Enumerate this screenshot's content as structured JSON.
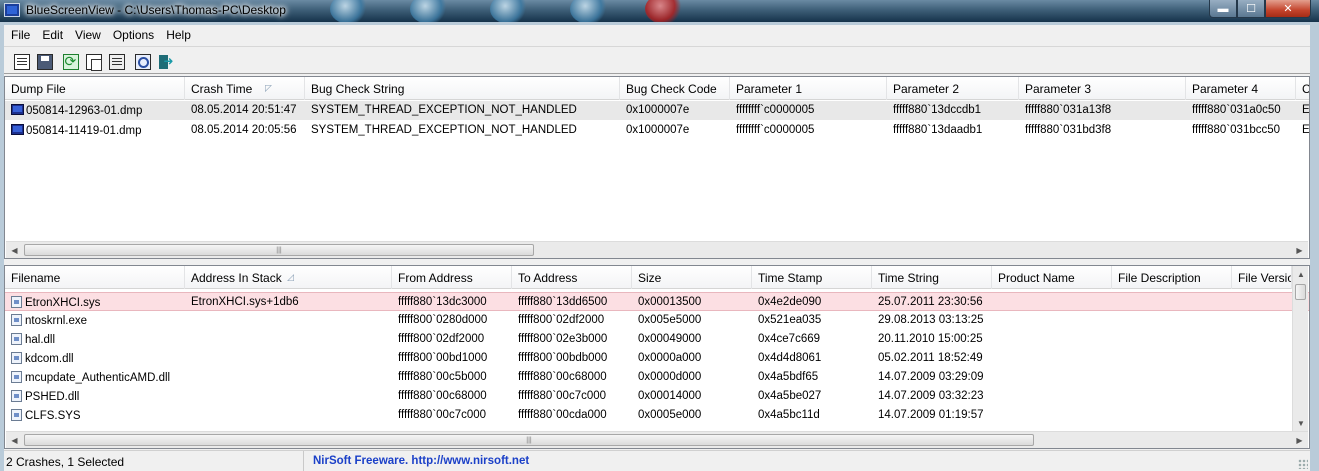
{
  "window": {
    "title": "BlueScreenView  -  C:\\Users\\Thomas-PC\\Desktop",
    "minimize_label": "▬",
    "maximize_label": "☐",
    "close_label": "✕"
  },
  "menu": [
    "File",
    "Edit",
    "View",
    "Options",
    "Help"
  ],
  "toolbar": [
    {
      "name": "html-report-icon",
      "type": "report"
    },
    {
      "name": "save-icon",
      "type": "save"
    },
    {
      "name": "refresh-icon",
      "type": "refresh"
    },
    {
      "name": "copy-icon",
      "type": "copy"
    },
    {
      "name": "properties-icon",
      "type": "props"
    },
    {
      "name": "find-icon",
      "type": "find"
    },
    {
      "name": "exit-icon",
      "type": "exit"
    }
  ],
  "crash_list": {
    "columns": [
      "Dump File",
      "Crash Time",
      "Bug Check String",
      "Bug Check Code",
      "Parameter 1",
      "Parameter 2",
      "Parameter 3",
      "Parameter 4",
      "C"
    ],
    "rows": [
      [
        "050814-12963-01.dmp",
        "08.05.2014 20:51:47",
        "SYSTEM_THREAD_EXCEPTION_NOT_HANDLED",
        "0x1000007e",
        "ffffffff`c0000005",
        "fffff880`13dccdb1",
        "fffff880`031a13f8",
        "fffff880`031a0c50",
        "E"
      ],
      [
        "050814-11419-01.dmp",
        "08.05.2014 20:05:56",
        "SYSTEM_THREAD_EXCEPTION_NOT_HANDLED",
        "0x1000007e",
        "ffffffff`c0000005",
        "fffff880`13daadb1",
        "fffff880`031bd3f8",
        "fffff880`031bcc50",
        "E"
      ]
    ],
    "selected_row": 0
  },
  "driver_list": {
    "columns": [
      "Filename",
      "Address In Stack",
      "From Address",
      "To Address",
      "Size",
      "Time Stamp",
      "Time String",
      "Product Name",
      "File Description",
      "File Versio"
    ],
    "rows": [
      [
        "EtronXHCI.sys",
        "EtronXHCI.sys+1db6",
        "fffff880`13dc3000",
        "fffff880`13dd6500",
        "0x00013500",
        "0x4e2de090",
        "25.07.2011 23:30:56",
        "",
        "",
        ""
      ],
      [
        "ntoskrnl.exe",
        "",
        "fffff800`0280d000",
        "fffff800`02df2000",
        "0x005e5000",
        "0x521ea035",
        "29.08.2013 03:13:25",
        "",
        "",
        ""
      ],
      [
        "hal.dll",
        "",
        "fffff800`02df2000",
        "fffff800`02e3b000",
        "0x00049000",
        "0x4ce7c669",
        "20.11.2010 15:00:25",
        "",
        "",
        ""
      ],
      [
        "kdcom.dll",
        "",
        "fffff800`00bd1000",
        "fffff800`00bdb000",
        "0x0000a000",
        "0x4d4d8061",
        "05.02.2011 18:52:49",
        "",
        "",
        ""
      ],
      [
        "mcupdate_AuthenticAMD.dll",
        "",
        "fffff880`00c5b000",
        "fffff880`00c68000",
        "0x0000d000",
        "0x4a5bdf65",
        "14.07.2009 03:29:09",
        "",
        "",
        ""
      ],
      [
        "PSHED.dll",
        "",
        "fffff880`00c68000",
        "fffff880`00c7c000",
        "0x00014000",
        "0x4a5be027",
        "14.07.2009 03:32:23",
        "",
        "",
        ""
      ],
      [
        "CLFS.SYS",
        "",
        "fffff880`00c7c000",
        "fffff880`00cda000",
        "0x0005e000",
        "0x4a5bc11d",
        "14.07.2009 01:19:57",
        "",
        "",
        ""
      ]
    ],
    "selected_row": 0
  },
  "status": {
    "summary": "2 Crashes, 1 Selected",
    "link": "NirSoft Freeware.  http://www.nirsoft.net"
  },
  "colors": {
    "selected_driver_row": "#fcdfe3",
    "link": "#1b40c8"
  }
}
